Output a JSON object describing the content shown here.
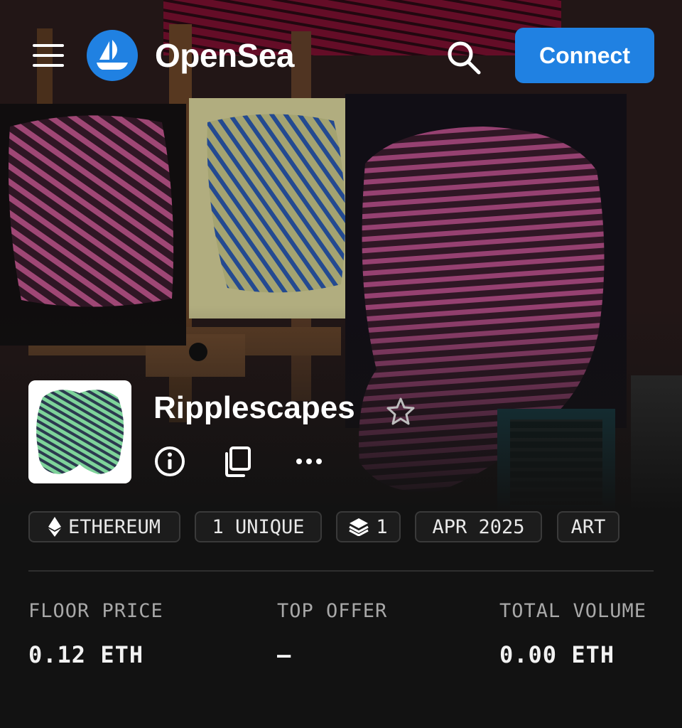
{
  "header": {
    "brand": "OpenSea",
    "connect_label": "Connect",
    "accent": "#2081e2"
  },
  "collection": {
    "name": "Ripplescapes",
    "banner_description": "Photo of ripple-pattern artworks on easels (pink and blue line paintings)"
  },
  "chips": [
    {
      "icon": "ethereum-icon",
      "label": "ETHEREUM"
    },
    {
      "icon": "",
      "label": "1 UNIQUE"
    },
    {
      "icon": "layers-icon",
      "label": "1"
    },
    {
      "icon": "",
      "label": "APR 2025"
    },
    {
      "icon": "",
      "label": "ART"
    }
  ],
  "stats": [
    {
      "label": "FLOOR PRICE",
      "value": "0.12 ETH"
    },
    {
      "label": "TOP OFFER",
      "value": "–"
    },
    {
      "label": "TOTAL VOLUME",
      "value": "0.00 ETH"
    }
  ]
}
